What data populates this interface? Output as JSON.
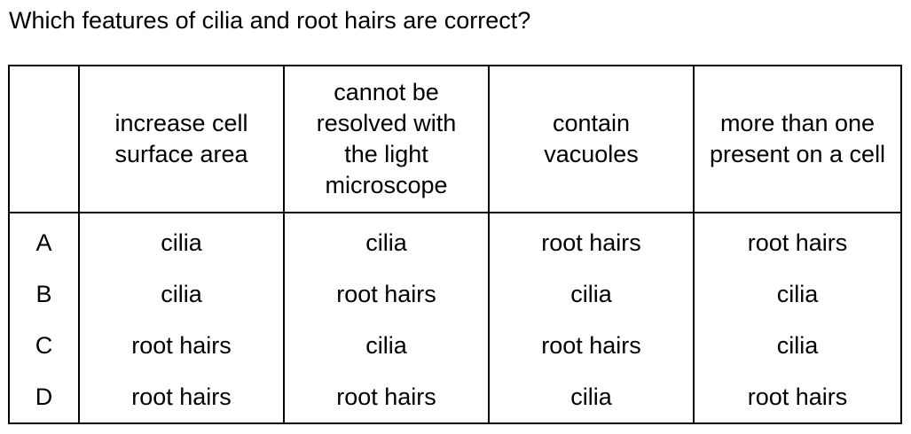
{
  "question": "Which features of cilia and root hairs are correct?",
  "table": {
    "headers": [
      "",
      "increase cell surface area",
      "cannot be resolved with the light microscope",
      "contain vacuoles",
      "more than one present on a cell"
    ],
    "rows": [
      {
        "letter": "A",
        "cells": [
          "cilia",
          "cilia",
          "root hairs",
          "root hairs"
        ]
      },
      {
        "letter": "B",
        "cells": [
          "cilia",
          "root hairs",
          "cilia",
          "cilia"
        ]
      },
      {
        "letter": "C",
        "cells": [
          "root hairs",
          "cilia",
          "root hairs",
          "cilia"
        ]
      },
      {
        "letter": "D",
        "cells": [
          "root hairs",
          "root hairs",
          "cilia",
          "root hairs"
        ]
      }
    ]
  }
}
